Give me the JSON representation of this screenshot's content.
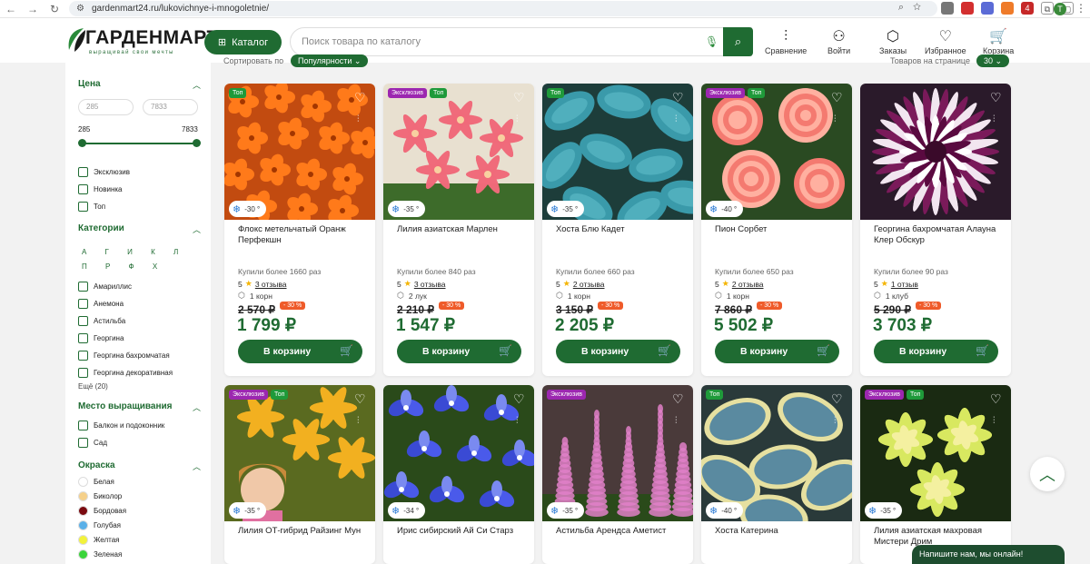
{
  "browser": {
    "url": "gardenmart24.ru/lukovichnye-i-mnogoletnie/",
    "profile_initial": "T",
    "ext_badge": "4"
  },
  "header": {
    "logo_name": "ГАРДЕНМАРТ",
    "logo_tagline": "выращивай свои мечты",
    "catalog_label": "Каталог",
    "search_placeholder": "Поиск товара по каталогу",
    "nav": {
      "compare": "Сравнение",
      "login": "Войти",
      "orders": "Заказы",
      "favorites": "Избранное",
      "cart": "Корзина"
    }
  },
  "sort": {
    "label": "Сортировать по",
    "value": "Популярности",
    "per_page_label": "Товаров на странице",
    "per_page_value": "30"
  },
  "filters": {
    "price_title": "Цена",
    "price_min_placeholder": "285",
    "price_max_placeholder": "7833",
    "price_min": "285",
    "price_max": "7833",
    "tags": [
      "Эксклюзив",
      "Новинка",
      "Топ"
    ],
    "categories_title": "Категории",
    "letters": "А Г И К Л П Р Ф Х",
    "categories": [
      "Амариллис",
      "Анемона",
      "Астильба",
      "Георгина",
      "Георгина бахромчатая",
      "Георгина декоративная"
    ],
    "more": "Ещё (20)",
    "place_title": "Место выращивания",
    "places": [
      "Балкон и подоконник",
      "Сад"
    ],
    "color_title": "Окраска",
    "colors": [
      {
        "name": "Белая",
        "hex": "#ffffff"
      },
      {
        "name": "Биколор",
        "hex": "#f5d08a"
      },
      {
        "name": "Бордовая",
        "hex": "#7a0a10"
      },
      {
        "name": "Голубая",
        "hex": "#5ab0e8"
      },
      {
        "name": "Желтая",
        "hex": "#f2f23a"
      },
      {
        "name": "Зеленая",
        "hex": "#3ad43a"
      }
    ]
  },
  "products": [
    {
      "badges": [
        {
          "t": "Топ",
          "k": "top"
        }
      ],
      "frost": "-30 °",
      "name": "Флокс метельчатый Оранж Перфекшн",
      "bought": "Купили более 1660 раз",
      "rating": "5",
      "reviews": "3 отзыва",
      "unit": "1 корн",
      "old_price": "2 570 ₽",
      "discount": "- 30 %",
      "price": "1 799 ₽",
      "buy": "В корзину"
    },
    {
      "badges": [
        {
          "t": "Эксклюзив",
          "k": "ex"
        },
        {
          "t": "Топ",
          "k": "top"
        }
      ],
      "frost": "-35 °",
      "name": "Лилия азиатская Марлен",
      "bought": "Купили более 840 раз",
      "rating": "5",
      "reviews": "3 отзыва",
      "unit": "2 лук",
      "old_price": "2 210 ₽",
      "discount": "- 30 %",
      "price": "1 547 ₽",
      "buy": "В корзину"
    },
    {
      "badges": [
        {
          "t": "Топ",
          "k": "top"
        }
      ],
      "frost": "-35 °",
      "name": "Хоста Блю Кадет",
      "bought": "Купили более 660 раз",
      "rating": "5",
      "reviews": "2 отзыва",
      "unit": "1 корн",
      "old_price": "3 150 ₽",
      "discount": "- 30 %",
      "price": "2 205 ₽",
      "buy": "В корзину"
    },
    {
      "badges": [
        {
          "t": "Эксклюзив",
          "k": "ex"
        },
        {
          "t": "Топ",
          "k": "top"
        }
      ],
      "frost": "-40 °",
      "name": "Пион Сорбет",
      "bought": "Купили более 650 раз",
      "rating": "5",
      "reviews": "2 отзыва",
      "unit": "1 корн",
      "old_price": "7 860 ₽",
      "discount": "- 30 %",
      "price": "5 502 ₽",
      "buy": "В корзину"
    },
    {
      "badges": [],
      "frost": "",
      "name": "Георгина бахромчатая Алауна Клер Обскур",
      "bought": "Купили более 90 раз",
      "rating": "5",
      "reviews": "1 отзыв",
      "unit": "1 клуб",
      "old_price": "5 290 ₽",
      "discount": "- 30 %",
      "price": "3 703 ₽",
      "buy": "В корзину"
    },
    {
      "badges": [
        {
          "t": "Эксклюзив",
          "k": "ex"
        },
        {
          "t": "Топ",
          "k": "top"
        }
      ],
      "frost": "-35 °",
      "name": "Лилия ОТ-гибрид Райзинг Мун"
    },
    {
      "badges": [],
      "frost": "-34 °",
      "name": "Ирис сибирский Ай Си Старз"
    },
    {
      "badges": [
        {
          "t": "Эксклюзив",
          "k": "ex"
        }
      ],
      "frost": "-35 °",
      "name": "Астильба Арендса Аметист"
    },
    {
      "badges": [
        {
          "t": "Топ",
          "k": "top"
        }
      ],
      "frost": "-40 °",
      "name": "Хоста Катерина"
    },
    {
      "badges": [
        {
          "t": "Эксклюзив",
          "k": "ex"
        },
        {
          "t": "Топ",
          "k": "top"
        }
      ],
      "frost": "-35 °",
      "name": "Лилия азиатская махровая Мистери Дрим"
    }
  ],
  "chat_label": "Напишите нам, мы онлайн!",
  "colors": {
    "brand_green": "#1f6b32",
    "discount": "#ef5b2a",
    "exclusive": "#9c27b0",
    "top": "#1f9a3a"
  }
}
